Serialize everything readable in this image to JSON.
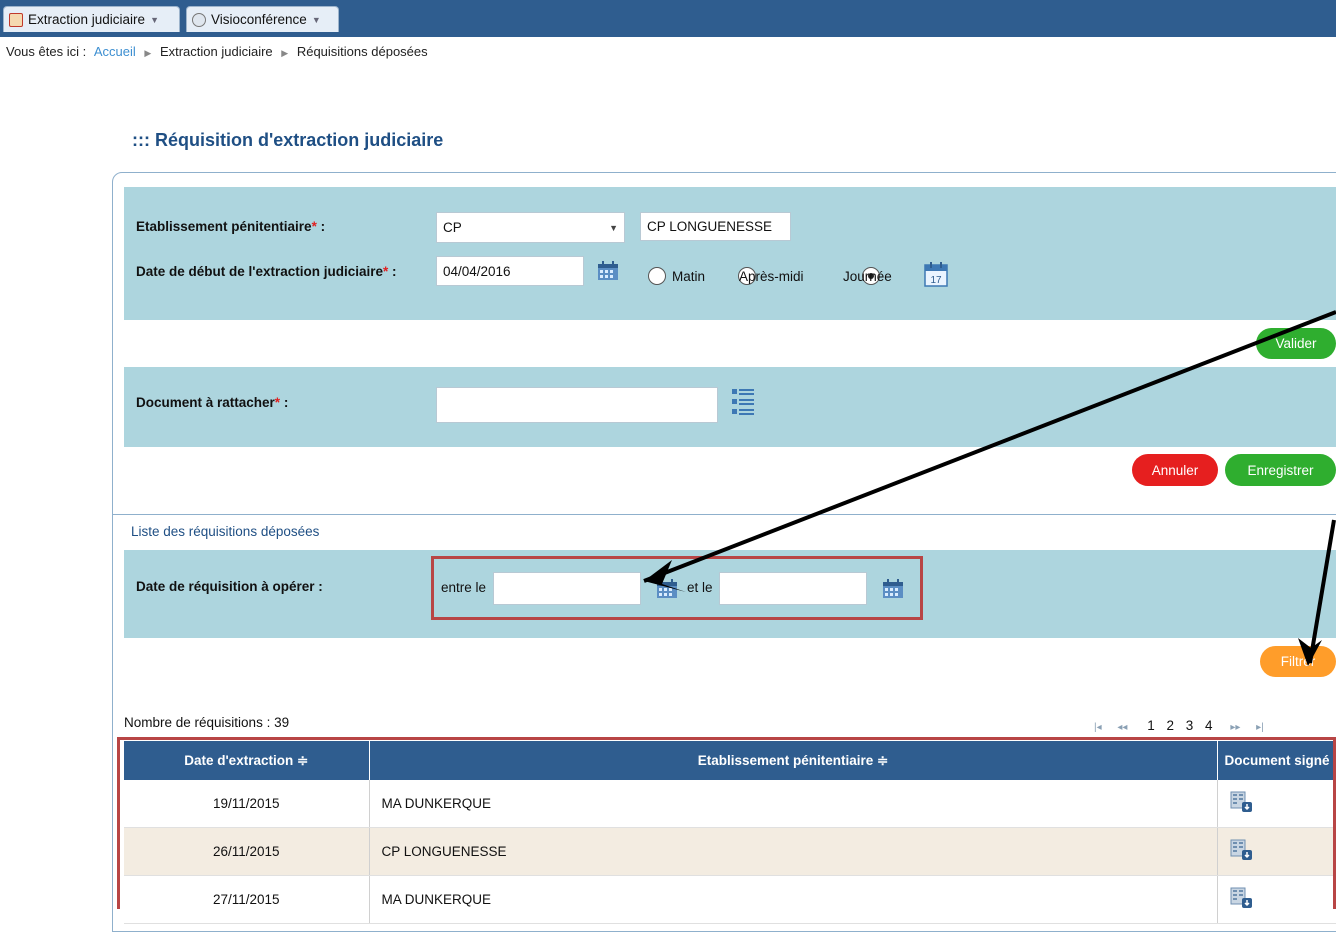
{
  "tabs": [
    {
      "label": "Extraction judiciaire",
      "icon": "extraction-icon"
    },
    {
      "label": "Visioconférence",
      "icon": "webcam-icon"
    }
  ],
  "breadcrumb": {
    "prefix": "Vous êtes ici :",
    "items": [
      "Accueil",
      "Extraction judiciaire",
      "Réquisitions déposées"
    ]
  },
  "page_title": "::: Réquisition d'extraction judiciaire",
  "form": {
    "etablissement_label": "Etablissement pénitentiaire",
    "etablissement_type": "CP",
    "etablissement_name": "CP LONGUENESSE",
    "date_label": "Date de début de l'extraction judiciaire",
    "date_value": "04/04/2016",
    "periods": [
      "Matin",
      "Après-midi",
      "Journée"
    ],
    "period_selected": "Journée",
    "required_mark": "*",
    "colon": " :",
    "validate_label": "Valider",
    "document_label": "Document à rattacher",
    "document_value": "",
    "cancel_label": "Annuler",
    "save_label": "Enregistrer"
  },
  "list": {
    "section_title": "Liste des réquisitions déposées",
    "filter_label": "Date de réquisition à opérer :",
    "between_label": "entre le",
    "and_label": "et le",
    "from_value": "",
    "to_value": "",
    "filter_button": "Filtrer",
    "count_text": "Nombre de réquisitions : 39",
    "pages": [
      "1",
      "2",
      "3",
      "4"
    ],
    "columns": [
      "Date d'extraction ≑",
      "Etablissement pénitentiaire ≑",
      "Document signé"
    ],
    "rows": [
      {
        "date": "19/11/2015",
        "etablissement": "MA DUNKERQUE"
      },
      {
        "date": "26/11/2015",
        "etablissement": "CP LONGUENESSE"
      },
      {
        "date": "27/11/2015",
        "etablissement": "MA DUNKERQUE"
      }
    ]
  },
  "colors": {
    "header": "#2f5d8f",
    "panel": "#add5de",
    "valider": "#2fae2f",
    "annuler": "#e61f1f",
    "filtrer": "#ff9d2a",
    "annotation_box": "#b84545"
  }
}
